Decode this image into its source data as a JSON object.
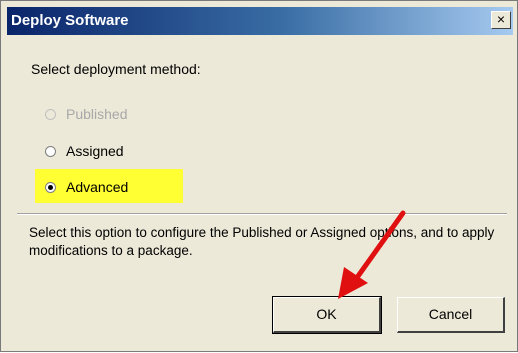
{
  "window": {
    "title": "Deploy Software",
    "close_label": "×"
  },
  "prompt": "Select deployment method:",
  "options": [
    {
      "label": "Published",
      "state": "disabled"
    },
    {
      "label": "Assigned",
      "state": "unselected"
    },
    {
      "label": "Advanced",
      "state": "selected"
    }
  ],
  "description": "Select this option to configure the Published or Assigned options, and to apply modifications to a package.",
  "buttons": {
    "ok": "OK",
    "cancel": "Cancel"
  },
  "colors": {
    "highlight": "#ffff33",
    "arrow": "#e01010",
    "titlebar": "#0a246a"
  },
  "icons": [
    "close-icon",
    "red-arrow-annotation"
  ]
}
